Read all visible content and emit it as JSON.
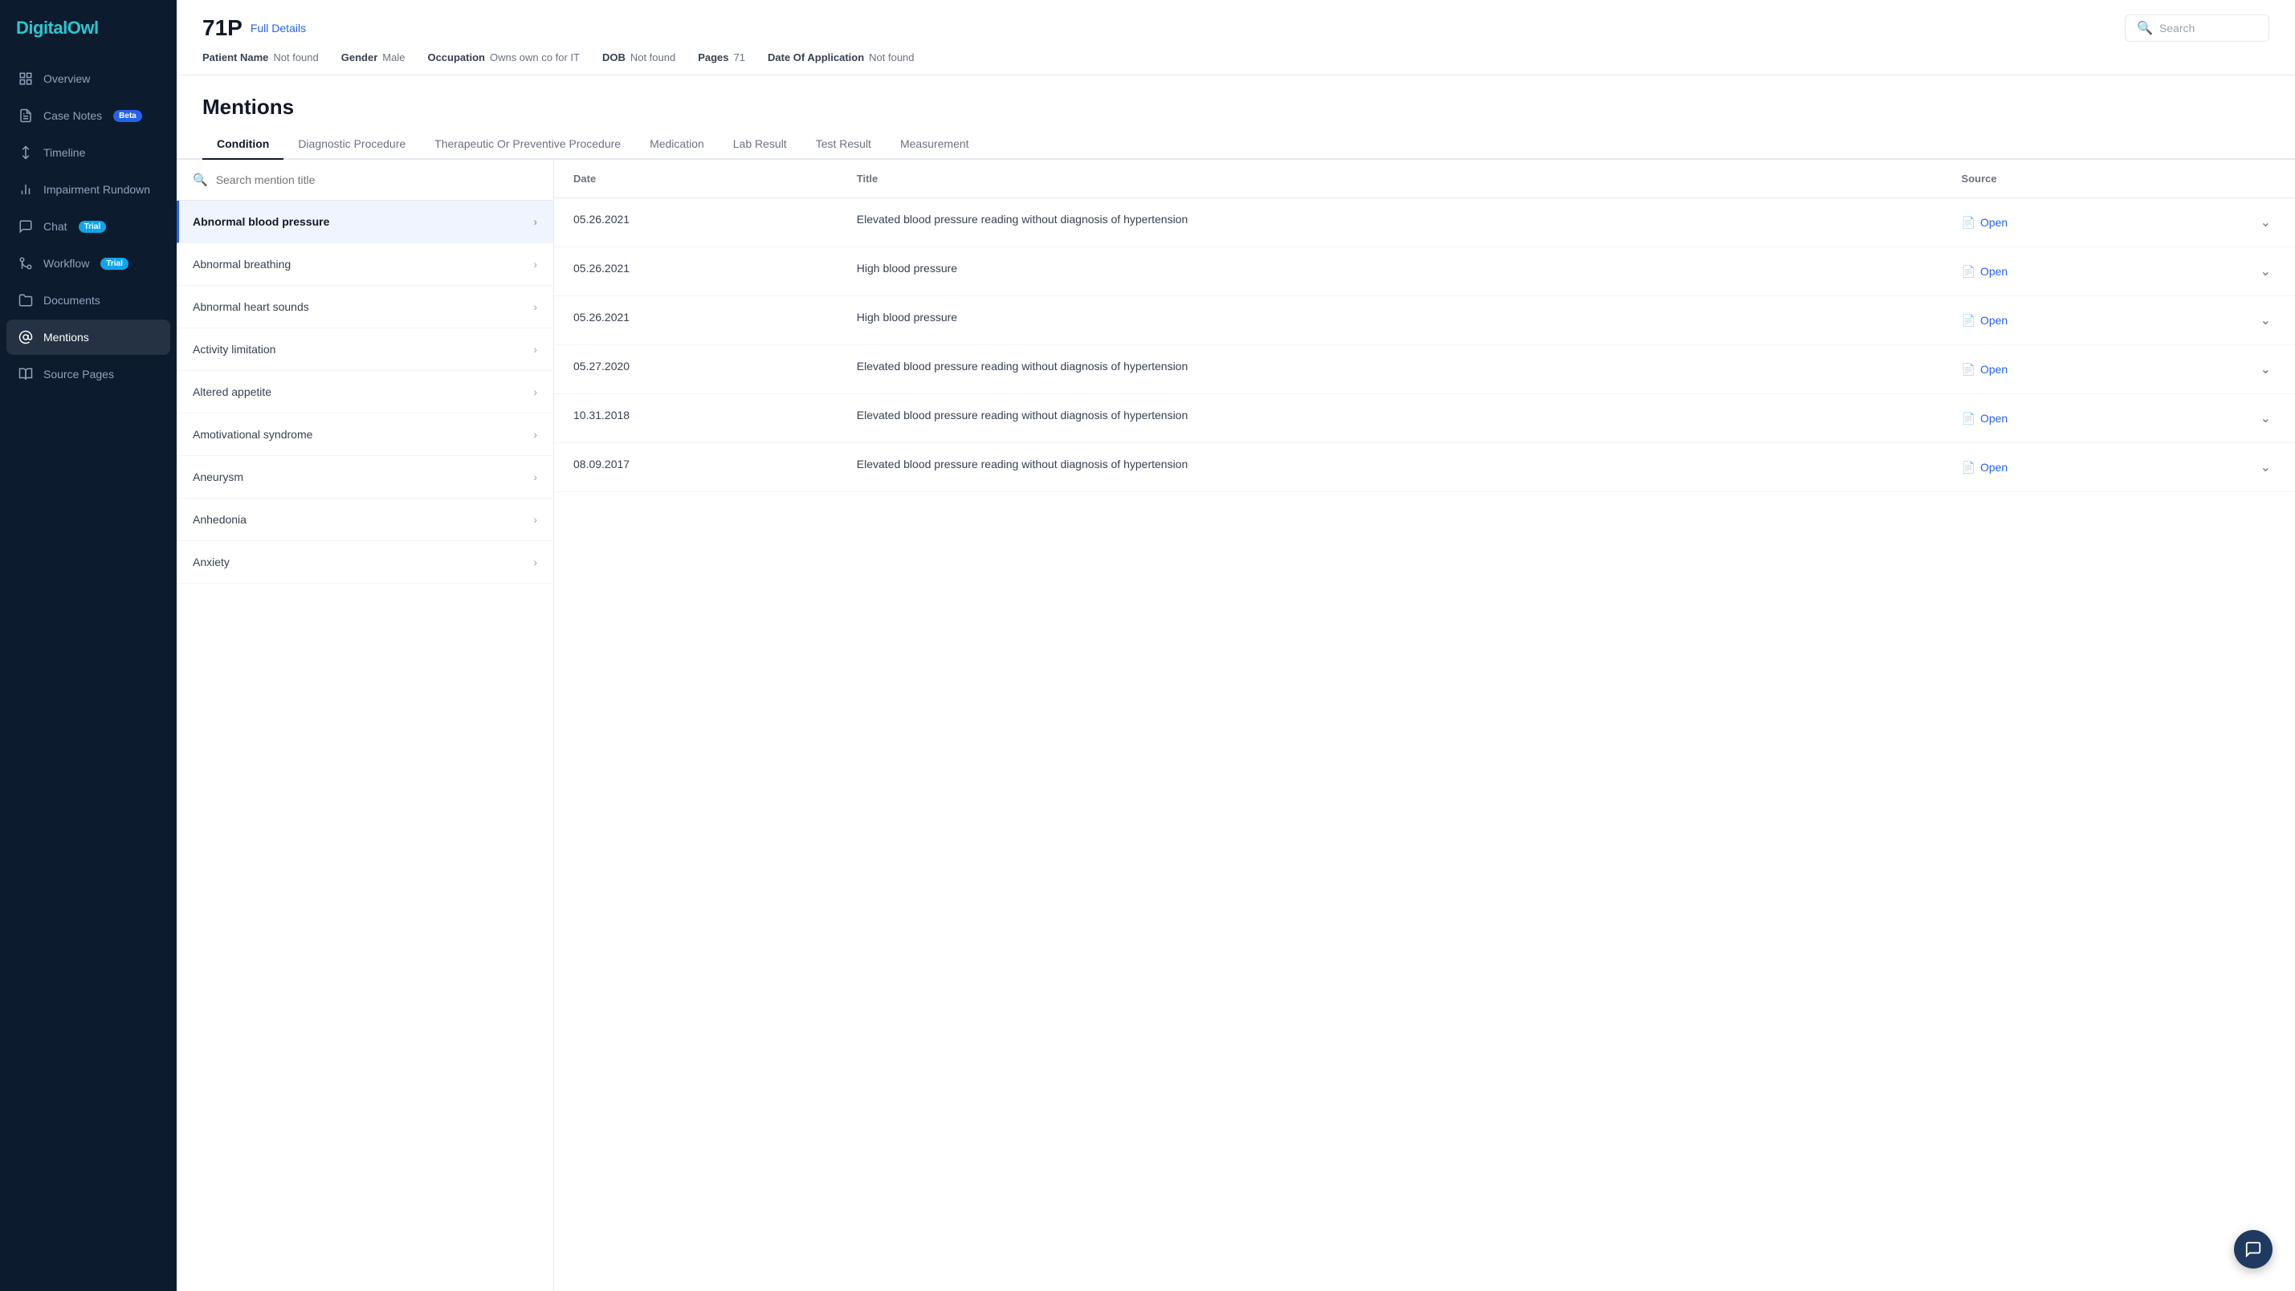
{
  "sidebar": {
    "logo": {
      "text1": "Digital",
      "text2": "Owl"
    },
    "items": [
      {
        "id": "overview",
        "label": "Overview",
        "icon": "grid",
        "active": false
      },
      {
        "id": "case-notes",
        "label": "Case Notes",
        "icon": "file-text",
        "badge": "Beta",
        "badgeType": "beta",
        "active": false
      },
      {
        "id": "timeline",
        "label": "Timeline",
        "icon": "git-branch",
        "active": false
      },
      {
        "id": "impairment-rundown",
        "label": "Impairment Rundown",
        "icon": "bar-chart",
        "active": false
      },
      {
        "id": "chat",
        "label": "Chat",
        "icon": "message-circle",
        "badge": "Trial",
        "badgeType": "trial",
        "active": false
      },
      {
        "id": "workflow",
        "label": "Workflow",
        "icon": "git-merge",
        "badge": "Trial",
        "badgeType": "trial",
        "active": false
      },
      {
        "id": "documents",
        "label": "Documents",
        "icon": "folder",
        "active": false
      },
      {
        "id": "mentions",
        "label": "Mentions",
        "icon": "at-sign",
        "active": true
      },
      {
        "id": "source-pages",
        "label": "Source Pages",
        "icon": "book-open",
        "active": false
      }
    ]
  },
  "header": {
    "patient_id": "71P",
    "full_details": "Full Details",
    "meta": [
      {
        "label": "Patient Name",
        "value": "Not found"
      },
      {
        "label": "Gender",
        "value": "Male"
      },
      {
        "label": "Occupation",
        "value": "Owns own co for IT"
      },
      {
        "label": "DOB",
        "value": "Not found"
      },
      {
        "label": "Pages",
        "value": "71"
      },
      {
        "label": "Date Of Application",
        "value": "Not found"
      }
    ],
    "search_placeholder": "Search"
  },
  "page": {
    "title": "Mentions"
  },
  "tabs": [
    {
      "id": "condition",
      "label": "Condition",
      "active": true
    },
    {
      "id": "diagnostic",
      "label": "Diagnostic Procedure",
      "active": false
    },
    {
      "id": "therapeutic",
      "label": "Therapeutic Or Preventive Procedure",
      "active": false
    },
    {
      "id": "medication",
      "label": "Medication",
      "active": false
    },
    {
      "id": "lab-result",
      "label": "Lab Result",
      "active": false
    },
    {
      "id": "test-result",
      "label": "Test Result",
      "active": false
    },
    {
      "id": "measurement",
      "label": "Measurement",
      "active": false
    }
  ],
  "list": {
    "search_placeholder": "Search mention title",
    "items": [
      {
        "id": "abnormal-blood-pressure",
        "label": "Abnormal blood pressure",
        "selected": true
      },
      {
        "id": "abnormal-breathing",
        "label": "Abnormal breathing",
        "selected": false
      },
      {
        "id": "abnormal-heart-sounds",
        "label": "Abnormal heart sounds",
        "selected": false
      },
      {
        "id": "activity-limitation",
        "label": "Activity limitation",
        "selected": false
      },
      {
        "id": "altered-appetite",
        "label": "Altered appetite",
        "selected": false
      },
      {
        "id": "amotivational-syndrome",
        "label": "Amotivational syndrome",
        "selected": false
      },
      {
        "id": "aneurysm",
        "label": "Aneurysm",
        "selected": false
      },
      {
        "id": "anhedonia",
        "label": "Anhedonia",
        "selected": false
      },
      {
        "id": "anxiety",
        "label": "Anxiety",
        "selected": false
      }
    ]
  },
  "detail": {
    "columns": [
      {
        "id": "date",
        "label": "Date"
      },
      {
        "id": "title",
        "label": "Title"
      },
      {
        "id": "source",
        "label": "Source"
      }
    ],
    "rows": [
      {
        "date": "05.26.2021",
        "title": "Elevated blood pressure reading without diagnosis of hypertension",
        "source": "Open"
      },
      {
        "date": "05.26.2021",
        "title": "High blood pressure",
        "source": "Open"
      },
      {
        "date": "05.26.2021",
        "title": "High blood pressure",
        "source": "Open"
      },
      {
        "date": "05.27.2020",
        "title": "Elevated blood pressure reading without diagnosis of hypertension",
        "source": "Open"
      },
      {
        "date": "10.31.2018",
        "title": "Elevated blood pressure reading without diagnosis of hypertension",
        "source": "Open"
      },
      {
        "date": "08.09.2017",
        "title": "Elevated blood pressure reading without diagnosis of hypertension",
        "source": "Open"
      }
    ]
  }
}
